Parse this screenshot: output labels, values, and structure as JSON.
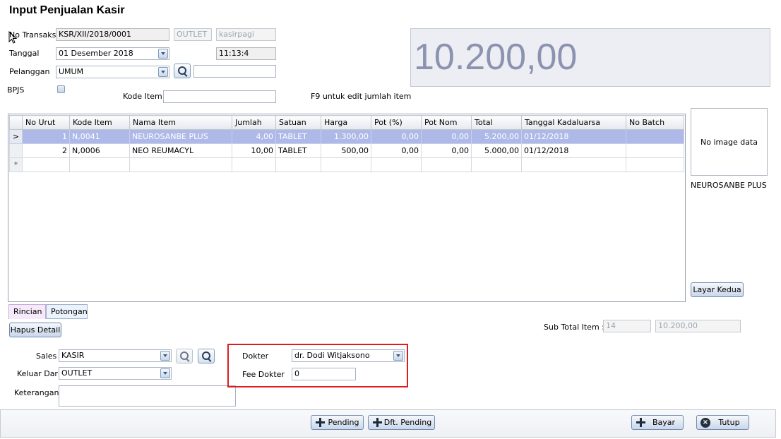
{
  "window": {
    "title": "Input Penjualan Kasir"
  },
  "header": {
    "no_transaksi_label": "No Transaksi",
    "no_transaksi_value": "KSR/XII/2018/0001",
    "outlet_value": "OUTLET",
    "user_value": "kasirpagi",
    "tanggal_label": "Tanggal",
    "tanggal_value": "01 Desember 2018",
    "time_value": "11:13:4",
    "pelanggan_label": "Pelanggan",
    "pelanggan_value": "UMUM",
    "pelanggan_name_value": "",
    "bpjs_label": "BPJS",
    "kode_item_label": "Kode Item",
    "kode_item_value": "",
    "f9_hint": "F9 untuk edit jumlah item"
  },
  "total_display": "10.200,00",
  "grid": {
    "columns": [
      "No Urut",
      "Kode Item",
      "Nama Item",
      "Jumlah",
      "Satuan",
      "Harga",
      "Pot (%)",
      "Pot Nom",
      "Total",
      "Tanggal Kadaluarsa",
      "No Batch"
    ],
    "rows": [
      {
        "no": "1",
        "kode": "N,0041",
        "nama": "NEUROSANBE PLUS",
        "jumlah": "4,00",
        "satuan": "TABLET",
        "harga": "1.300,00",
        "pot_pct": "0,00",
        "pot_nom": "0,00",
        "total": "5.200,00",
        "kadaluarsa": "01/12/2018",
        "batch": "",
        "indicator": ">"
      },
      {
        "no": "2",
        "kode": "N,0006",
        "nama": "NEO REUMACYL",
        "jumlah": "10,00",
        "satuan": "TABLET",
        "harga": "500,00",
        "pot_pct": "0,00",
        "pot_nom": "0,00",
        "total": "5.000,00",
        "kadaluarsa": "01/12/2018",
        "batch": "",
        "indicator": ""
      }
    ],
    "new_row_indicator": "*"
  },
  "image_panel": {
    "placeholder": "No image data",
    "item_name": "NEUROSANBE PLUS"
  },
  "layar_kedua_label": "Layar Kedua",
  "tabs": [
    {
      "label": "Rincian"
    },
    {
      "label": "Potongan"
    }
  ],
  "hapus_detail_label": "Hapus Detail",
  "subtotal": {
    "label": "Sub Total Item :",
    "count": "14",
    "amount": "10.200,00"
  },
  "bottom_form": {
    "sales_label": "Sales",
    "sales_value": "KASIR",
    "keluar_label": "Keluar Dari",
    "keluar_value": "OUTLET",
    "keterangan_label": "Keterangan",
    "keterangan_value": "",
    "dokter_label": "Dokter",
    "dokter_value": "dr. Dodi Witjaksono",
    "fee_label": "Fee Dokter",
    "fee_value": "0"
  },
  "footer": {
    "pending_label": "Pending",
    "dft_pending_label": "Dft. Pending",
    "bayar_label": "Bayar",
    "tutup_label": "Tutup"
  },
  "colors": {
    "highlight_box": "#e01c1c",
    "selected_row": "#aeb9e8",
    "total_text": "#8c93b1"
  }
}
